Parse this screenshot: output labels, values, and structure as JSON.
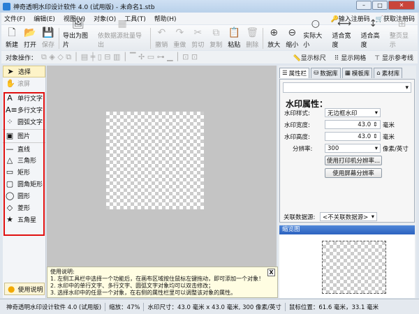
{
  "window": {
    "title": "神奇透明水印设计软件 4.0 (试用版) - 未命名1.stb"
  },
  "menu": {
    "items": [
      "文件(F)",
      "编辑(E)",
      "视图(V)",
      "对象(O)",
      "工具(T)",
      "帮助(H)"
    ],
    "register": "输入注册码",
    "buy": "获取注册码"
  },
  "toolbar": [
    {
      "label": "新建",
      "icon": "new-file-icon",
      "enabled": true
    },
    {
      "label": "打开",
      "icon": "open-icon",
      "enabled": true
    },
    {
      "label": "保存",
      "icon": "save-icon",
      "enabled": false
    },
    {
      "label": "导出为图片",
      "icon": "export-image-icon",
      "enabled": true
    },
    {
      "label": "依数据源批量导出",
      "icon": "batch-export-icon",
      "enabled": false
    },
    {
      "label": "撤销",
      "icon": "undo-icon",
      "enabled": false
    },
    {
      "label": "重做",
      "icon": "redo-icon",
      "enabled": false
    },
    {
      "label": "剪切",
      "icon": "cut-icon",
      "enabled": false
    },
    {
      "label": "复制",
      "icon": "copy-icon",
      "enabled": false
    },
    {
      "label": "粘贴",
      "icon": "paste-icon",
      "enabled": true
    },
    {
      "label": "删除",
      "icon": "delete-icon",
      "enabled": false
    },
    {
      "label": "放大",
      "icon": "zoom-in-icon",
      "enabled": true
    },
    {
      "label": "缩小",
      "icon": "zoom-out-icon",
      "enabled": true
    },
    {
      "label": "实际大小",
      "icon": "actual-size-icon",
      "enabled": true
    },
    {
      "label": "适合宽度",
      "icon": "fit-width-icon",
      "enabled": true
    },
    {
      "label": "适合高度",
      "icon": "fit-height-icon",
      "enabled": true
    },
    {
      "label": "整页显示",
      "icon": "fit-page-icon",
      "enabled": false
    }
  ],
  "objops": {
    "label": "对象操作：",
    "show_ruler": "显示标尺",
    "show_grid": "显示网格",
    "show_guides": "显示参考线"
  },
  "tools": [
    {
      "label": "选择",
      "glyph": "➤",
      "name": "select"
    },
    {
      "label": "滚屏",
      "glyph": "✋",
      "name": "pan"
    },
    {
      "label": "单行文字",
      "glyph": "A",
      "name": "single-line-text"
    },
    {
      "label": "多行文字",
      "glyph": "A≡",
      "name": "multi-line-text"
    },
    {
      "label": "圆弧文字",
      "glyph": "⁘",
      "name": "arc-text"
    },
    {
      "label": "图片",
      "glyph": "▣",
      "name": "image"
    },
    {
      "label": "直线",
      "glyph": "—",
      "name": "line"
    },
    {
      "label": "三角形",
      "glyph": "△",
      "name": "triangle"
    },
    {
      "label": "矩形",
      "glyph": "▭",
      "name": "rectangle"
    },
    {
      "label": "圆角矩形",
      "glyph": "▢",
      "name": "rounded-rectangle"
    },
    {
      "label": "圆形",
      "glyph": "◯",
      "name": "ellipse"
    },
    {
      "label": "菱形",
      "glyph": "◇",
      "name": "diamond"
    },
    {
      "label": "五角星",
      "glyph": "★",
      "name": "star"
    }
  ],
  "help": {
    "button": "使用说明",
    "title": "使用说明:",
    "lines": [
      "1. 左侧工具栏中选择一个功能后，在画布区域按住鼠标左键拖动，即可添加一个对象！",
      "2. 水印中的单行文字、多行文字、圆弧文字对象均可以双击修改；",
      "3. 选择水印中的任意一个对象，在右侧的属性栏里可以调整该对象的属性。"
    ],
    "close": "X"
  },
  "right": {
    "tabs": [
      "属性栏",
      "数据库",
      "模板库",
      "素材库"
    ],
    "heading": "水印属性：",
    "style_label": "水印样式:",
    "style_value": "无边框水印",
    "width_label": "水印宽度:",
    "width_value": "43.0",
    "height_label": "水印高度:",
    "height_value": "43.0",
    "unit": "毫米",
    "dpi_label": "分辨率:",
    "dpi_value": "300",
    "dpi_unit": "像素/英寸",
    "printer_dpi_btn": "使用打印机分辨率...",
    "screen_dpi_btn": "使用屏幕分辨率",
    "datasource_label": "关联数据源:",
    "datasource_value": "<不关联数据源>",
    "thumb_title": "缩览图"
  },
  "status": [
    "神奇透明水印设计软件 4.0 (试用版)",
    "缩放：47%",
    "水印尺寸：43.0 毫米 x 43.0 毫米, 300 像素/英寸",
    "鼠标位置：61.6 毫米，33.1 毫米"
  ]
}
